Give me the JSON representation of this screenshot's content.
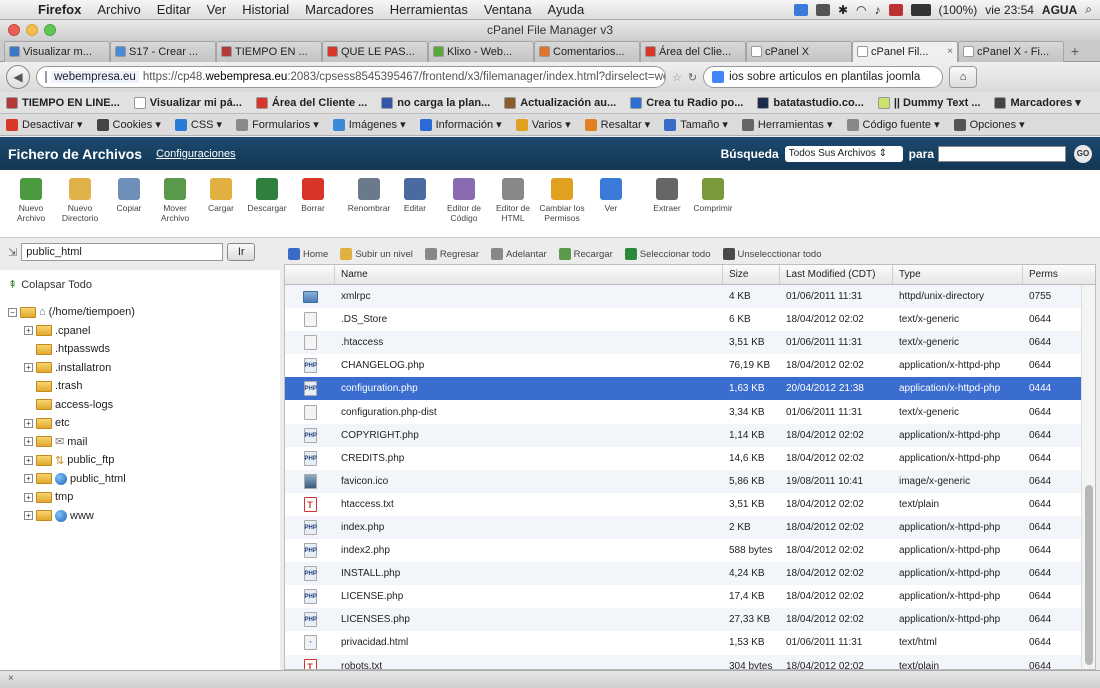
{
  "menubar": {
    "apple": "",
    "items": [
      "Firefox",
      "Archivo",
      "Editar",
      "Ver",
      "Historial",
      "Marcadores",
      "Herramientas",
      "Ventana",
      "Ayuda"
    ],
    "battery": "(100%)",
    "clock": "vie 23:54",
    "user": "AGUA"
  },
  "window": {
    "title": "cPanel File Manager v3"
  },
  "tabs": [
    {
      "label": "Visualizar m...",
      "color": "#3a78c9",
      "active": false
    },
    {
      "label": "S17 - Crear ...",
      "color": "#4a8bd6",
      "active": false
    },
    {
      "label": "TIEMPO EN ...",
      "color": "#b23a3a",
      "active": false
    },
    {
      "label": "QUE LE PAS...",
      "color": "#d9352b",
      "active": false
    },
    {
      "label": "Klixo - Web...",
      "color": "#58a83a",
      "active": false
    },
    {
      "label": "Comentarios...",
      "color": "#e0752b",
      "active": false
    },
    {
      "label": "Área del Clie...",
      "color": "#d9352b",
      "active": false
    },
    {
      "label": "cPanel X",
      "color": "#ffffff",
      "active": false
    },
    {
      "label": "cPanel Fil...",
      "color": "#ffffff",
      "active": true
    },
    {
      "label": "cPanel X - Fi...",
      "color": "#ffffff",
      "active": false
    }
  ],
  "tab_close": "×",
  "tab_new": "+",
  "navbar": {
    "back": "◀",
    "url_prefix": "https://cp48.",
    "url_domain": "webempresa.eu",
    "url_rest": ":2083/cpsess8545395467/frontend/x3/filemanager/index.html?dirselect=webroot&",
    "url_label": "webempresa.eu",
    "search_text": "ios sobre articulos en plantilas joomla",
    "home": "⌂"
  },
  "bookmarks": [
    {
      "label": "TIEMPO EN LINE...",
      "color": "#b23a3a"
    },
    {
      "label": "Visualizar mi pá...",
      "color": "#ffffff"
    },
    {
      "label": "Área del Cliente ...",
      "color": "#d9352b"
    },
    {
      "label": "no carga la plan...",
      "color": "#3355aa"
    },
    {
      "label": "Actualización au...",
      "color": "#8a5a2b"
    },
    {
      "label": "Crea tu Radio po...",
      "color": "#2b6fd0"
    },
    {
      "label": "batatastudio.co...",
      "color": "#1b2b4b"
    },
    {
      "label": "|| Dummy Text ...",
      "color": "#c9e26a"
    },
    {
      "label": "Marcadores ▾",
      "color": "#444444"
    }
  ],
  "devbar": [
    {
      "label": "Desactivar ▾",
      "color": "#d83a2a"
    },
    {
      "label": "Cookies ▾",
      "color": "#444444"
    },
    {
      "label": "CSS ▾",
      "color": "#2a7ad8"
    },
    {
      "label": "Formularios ▾",
      "color": "#8a8a8a"
    },
    {
      "label": "Imágenes ▾",
      "color": "#3a8ad8"
    },
    {
      "label": "Información ▾",
      "color": "#2a6ad8"
    },
    {
      "label": "Varios ▾",
      "color": "#e0a020"
    },
    {
      "label": "Resaltar ▾",
      "color": "#e08020"
    },
    {
      "label": "Tamaño ▾",
      "color": "#3a6ac8"
    },
    {
      "label": "Herramientas ▾",
      "color": "#666666"
    },
    {
      "label": "Código fuente ▾",
      "color": "#888888"
    },
    {
      "label": "Opciones ▾",
      "color": "#555555"
    }
  ],
  "fm": {
    "title": "Fichero de Archivos",
    "settings": "Configuraciones",
    "search_label": "Búsqueda",
    "search_scope": "Todos Sus Archivos  ⇕",
    "para": "para",
    "go": "GO"
  },
  "toolbar": [
    {
      "label": "Nuevo Archivo",
      "color": "#4c9a3f"
    },
    {
      "label": "Nuevo Directorio",
      "color": "#e2b24a"
    },
    {
      "label": "Copiar",
      "color": "#6f8fb8"
    },
    {
      "label": "Mover Archivo",
      "color": "#5a9a4a"
    },
    {
      "label": "Cargar",
      "color": "#e0b040"
    },
    {
      "label": "Descargar",
      "color": "#2f7f3f"
    },
    {
      "label": "Borrar",
      "color": "#d8342a"
    },
    {
      "label": "Renombrar",
      "color": "#6a7a8a"
    },
    {
      "label": "Editar",
      "color": "#4a6aa0"
    },
    {
      "label": "Editor de Código",
      "color": "#8a6ab0"
    },
    {
      "label": "Editor de HTML",
      "color": "#888888"
    },
    {
      "label": "Cambiar los Permisos",
      "color": "#e0a020"
    },
    {
      "label": "Ver",
      "color": "#3a7ad8"
    },
    {
      "label": "Extraer",
      "color": "#666666"
    },
    {
      "label": "Comprimir",
      "color": "#7a9a3a"
    }
  ],
  "path": {
    "value": "public_html",
    "go": "Ir"
  },
  "actions": [
    {
      "label": "Home",
      "color": "#3a6ac8"
    },
    {
      "label": "Subir un nivel",
      "color": "#e0b040"
    },
    {
      "label": "Regresar",
      "color": "#888888"
    },
    {
      "label": "Adelantar",
      "color": "#888888"
    },
    {
      "label": "Recargar",
      "color": "#5a9a4a"
    },
    {
      "label": "Seleccionar todo",
      "color": "#2a8a3a"
    },
    {
      "label": "Unselecctionar todo",
      "color": "#4a4a4a"
    }
  ],
  "tree": {
    "collapse_label": "Colapsar Todo",
    "root": "(/home/tiempoen)",
    "nodes": [
      {
        "label": ".cpanel",
        "expander": "+",
        "kind": "folder"
      },
      {
        "label": ".htpasswds",
        "expander": "",
        "kind": "folder"
      },
      {
        "label": ".installatron",
        "expander": "+",
        "kind": "folder"
      },
      {
        "label": ".trash",
        "expander": "",
        "kind": "folder"
      },
      {
        "label": "access-logs",
        "expander": "",
        "kind": "folder"
      },
      {
        "label": "etc",
        "expander": "+",
        "kind": "folder"
      },
      {
        "label": "mail",
        "expander": "+",
        "kind": "mail"
      },
      {
        "label": "public_ftp",
        "expander": "+",
        "kind": "ftp"
      },
      {
        "label": "public_html",
        "expander": "+",
        "kind": "globe"
      },
      {
        "label": "tmp",
        "expander": "+",
        "kind": "folder"
      },
      {
        "label": "www",
        "expander": "+",
        "kind": "globe"
      }
    ]
  },
  "table": {
    "headers": [
      "Name",
      "Size",
      "Last Modified (CDT)",
      "Type",
      "Perms"
    ],
    "rows": [
      {
        "icon": "dir",
        "name": "xmlrpc",
        "size": "4 KB",
        "date": "01/06/2011 11:31",
        "type": "httpd/unix-directory",
        "perms": "0755",
        "selected": false
      },
      {
        "icon": "file",
        "name": ".DS_Store",
        "size": "6 KB",
        "date": "18/04/2012 02:02",
        "type": "text/x-generic",
        "perms": "0644",
        "selected": false
      },
      {
        "icon": "file",
        "name": ".htaccess",
        "size": "3,51 KB",
        "date": "01/06/2011 11:31",
        "type": "text/x-generic",
        "perms": "0644",
        "selected": false
      },
      {
        "icon": "php",
        "name": "CHANGELOG.php",
        "size": "76,19 KB",
        "date": "18/04/2012 02:02",
        "type": "application/x-httpd-php",
        "perms": "0644",
        "selected": false
      },
      {
        "icon": "php",
        "name": "configuration.php",
        "size": "1,63 KB",
        "date": "20/04/2012 21:38",
        "type": "application/x-httpd-php",
        "perms": "0444",
        "selected": true
      },
      {
        "icon": "file",
        "name": "configuration.php-dist",
        "size": "3,34 KB",
        "date": "01/06/2011 11:31",
        "type": "text/x-generic",
        "perms": "0644",
        "selected": false
      },
      {
        "icon": "php",
        "name": "COPYRIGHT.php",
        "size": "1,14 KB",
        "date": "18/04/2012 02:02",
        "type": "application/x-httpd-php",
        "perms": "0644",
        "selected": false
      },
      {
        "icon": "php",
        "name": "CREDITS.php",
        "size": "14,6 KB",
        "date": "18/04/2012 02:02",
        "type": "application/x-httpd-php",
        "perms": "0644",
        "selected": false
      },
      {
        "icon": "img",
        "name": "favicon.ico",
        "size": "5,86 KB",
        "date": "19/08/2011 10:41",
        "type": "image/x-generic",
        "perms": "0644",
        "selected": false
      },
      {
        "icon": "txt",
        "name": "htaccess.txt",
        "size": "3,51 KB",
        "date": "18/04/2012 02:02",
        "type": "text/plain",
        "perms": "0644",
        "selected": false
      },
      {
        "icon": "php",
        "name": "index.php",
        "size": "2 KB",
        "date": "18/04/2012 02:02",
        "type": "application/x-httpd-php",
        "perms": "0644",
        "selected": false
      },
      {
        "icon": "php",
        "name": "index2.php",
        "size": "588 bytes",
        "date": "18/04/2012 02:02",
        "type": "application/x-httpd-php",
        "perms": "0644",
        "selected": false
      },
      {
        "icon": "php",
        "name": "INSTALL.php",
        "size": "4,24 KB",
        "date": "18/04/2012 02:02",
        "type": "application/x-httpd-php",
        "perms": "0644",
        "selected": false
      },
      {
        "icon": "php",
        "name": "LICENSE.php",
        "size": "17,4 KB",
        "date": "18/04/2012 02:02",
        "type": "application/x-httpd-php",
        "perms": "0644",
        "selected": false
      },
      {
        "icon": "php",
        "name": "LICENSES.php",
        "size": "27,33 KB",
        "date": "18/04/2012 02:02",
        "type": "application/x-httpd-php",
        "perms": "0644",
        "selected": false
      },
      {
        "icon": "html",
        "name": "privacidad.html",
        "size": "1,53 KB",
        "date": "01/06/2011 11:31",
        "type": "text/html",
        "perms": "0644",
        "selected": false
      },
      {
        "icon": "txt",
        "name": "robots.txt",
        "size": "304 bytes",
        "date": "18/04/2012 02:02",
        "type": "text/plain",
        "perms": "0644",
        "selected": false
      }
    ]
  },
  "statusbar": {
    "close": "×"
  }
}
